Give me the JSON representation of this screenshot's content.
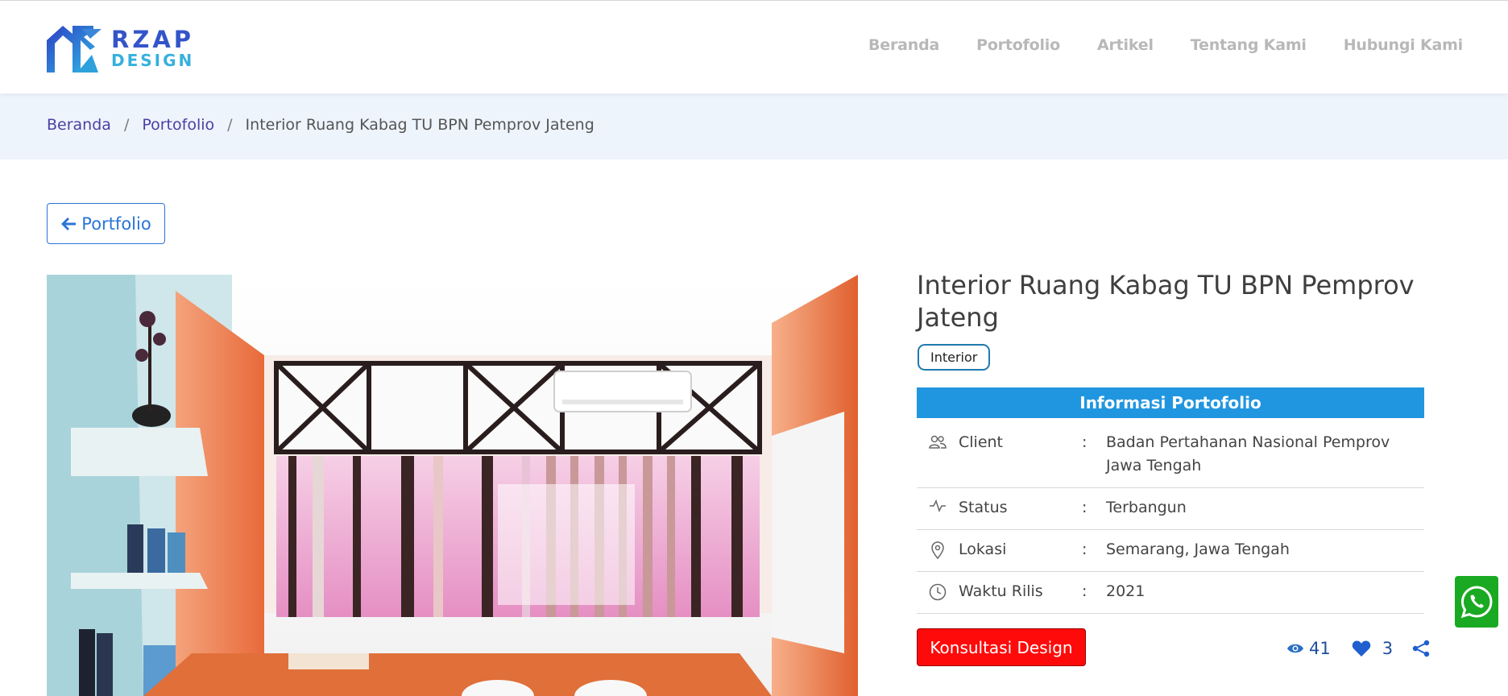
{
  "header": {
    "logo": {
      "line1": "RZAP",
      "line2": "DESIGN"
    },
    "nav": [
      "Beranda",
      "Portofolio",
      "Artikel",
      "Tentang Kami",
      "Hubungi Kami"
    ]
  },
  "breadcrumb": {
    "home": "Beranda",
    "section": "Portofolio",
    "current": "Interior Ruang Kabag TU BPN Pemprov Jateng",
    "separator": "/"
  },
  "back_button": {
    "label": "Portfolio",
    "icon": "arrow-left-icon"
  },
  "portfolio": {
    "title": "Interior Ruang Kabag TU BPN Pemprov Jateng",
    "tag": "Interior",
    "info_heading": "Informasi Portofolio",
    "rows": [
      {
        "icon": "users-icon",
        "label": "Client",
        "colon": ":",
        "value": "Badan Pertahanan Nasional Pemprov Jawa Tengah"
      },
      {
        "icon": "activity-icon",
        "label": "Status",
        "colon": ":",
        "value": "Terbangun"
      },
      {
        "icon": "location-pin-icon",
        "label": "Lokasi",
        "colon": ":",
        "value": "Semarang, Jawa Tengah"
      },
      {
        "icon": "clock-icon",
        "label": "Waktu Rilis",
        "colon": ":",
        "value": "2021"
      }
    ],
    "cta": "Konsultasi Design",
    "views": "41",
    "likes": "3"
  },
  "colors": {
    "accent": "#2196e0",
    "cta": "#ff0a0a",
    "whatsapp": "#1aa922",
    "breadcrumb_bg": "#eef4fc"
  }
}
